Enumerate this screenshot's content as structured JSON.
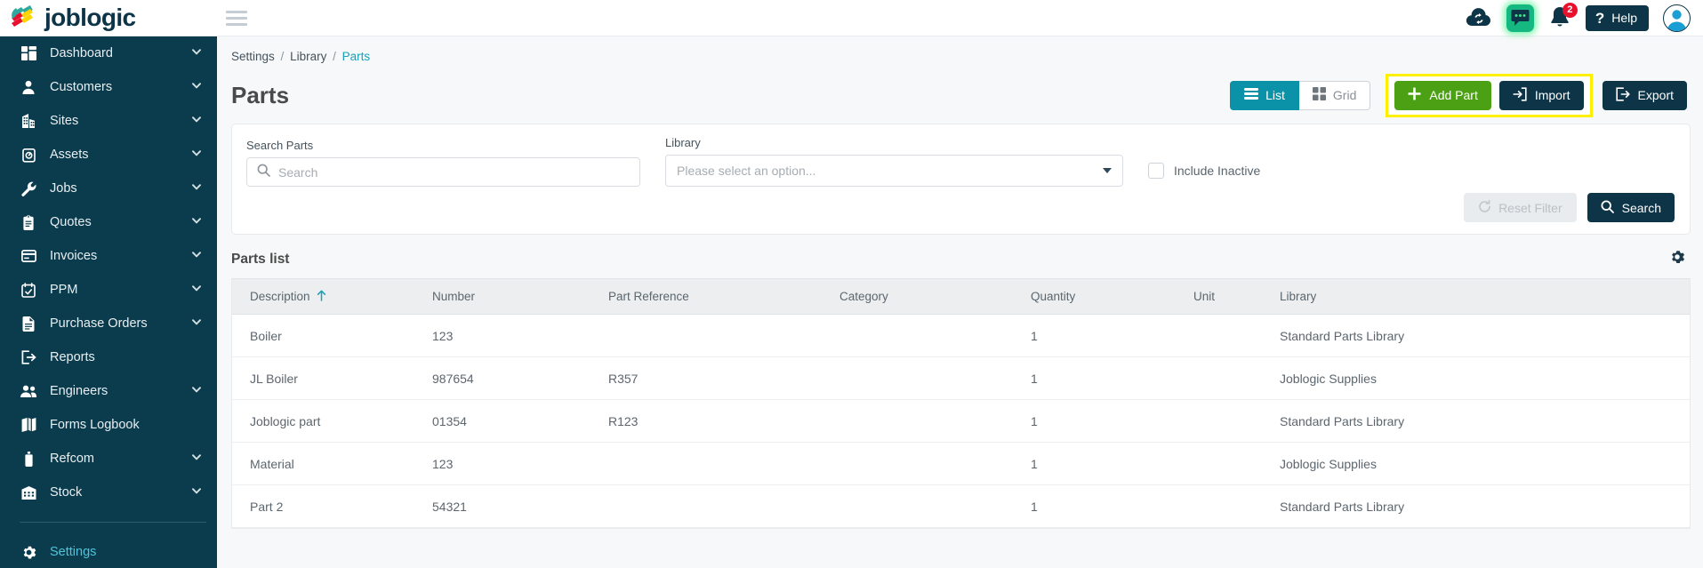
{
  "brand": {
    "name": "joblogic",
    "logo_colors": [
      "#2fa8a0",
      "#e8112d",
      "#ffd400",
      "#0d3547"
    ]
  },
  "topbar": {
    "hamburger_icon": "hamburger-menu-icon",
    "icons": [
      {
        "name": "cloud-sync-icon",
        "label": "Cloud Sync"
      },
      {
        "name": "chat-bubble-icon",
        "label": "Chat"
      },
      {
        "name": "bell-notification-icon",
        "label": "Notifications",
        "badge": "2"
      }
    ],
    "help_label": "Help",
    "help_icon": "question-mark-icon",
    "avatar_icon": "user-avatar-icon"
  },
  "sidebar": {
    "items": [
      {
        "label": "Dashboard",
        "icon": "dashboard-grid-icon",
        "expandable": true
      },
      {
        "label": "Customers",
        "icon": "person-icon",
        "expandable": true
      },
      {
        "label": "Sites",
        "icon": "building-icon",
        "expandable": true
      },
      {
        "label": "Assets",
        "icon": "asset-tag-icon",
        "expandable": true
      },
      {
        "label": "Jobs",
        "icon": "wrench-icon",
        "expandable": true
      },
      {
        "label": "Quotes",
        "icon": "clipboard-icon",
        "expandable": true
      },
      {
        "label": "Invoices",
        "icon": "invoice-card-icon",
        "expandable": true
      },
      {
        "label": "PPM",
        "icon": "calendar-check-icon",
        "expandable": true
      },
      {
        "label": "Purchase Orders",
        "icon": "document-lines-icon",
        "expandable": true
      },
      {
        "label": "Reports",
        "icon": "report-export-icon",
        "expandable": false
      },
      {
        "label": "Engineers",
        "icon": "people-group-icon",
        "expandable": true
      },
      {
        "label": "Forms Logbook",
        "icon": "open-book-icon",
        "expandable": false
      },
      {
        "label": "Refcom",
        "icon": "gas-cylinder-icon",
        "expandable": true
      },
      {
        "label": "Stock",
        "icon": "warehouse-icon",
        "expandable": true
      }
    ],
    "bottom_item": {
      "label": "Settings",
      "icon": "gear-icon",
      "active": true
    }
  },
  "breadcrumb": {
    "items": [
      "Settings",
      "Library",
      "Parts"
    ],
    "separator": "/",
    "active_index": 2
  },
  "header": {
    "title": "Parts",
    "view_toggle": [
      {
        "label": "List",
        "icon": "list-view-icon",
        "selected": true
      },
      {
        "label": "Grid",
        "icon": "grid-view-icon",
        "selected": false
      }
    ],
    "buttons": [
      {
        "label": "Add Part",
        "icon": "plus-icon",
        "style": "green",
        "highlighted": true
      },
      {
        "label": "Import",
        "icon": "import-arrow-icon",
        "style": "dark",
        "highlighted": true
      },
      {
        "label": "Export",
        "icon": "export-arrow-icon",
        "style": "dark",
        "highlighted": false
      }
    ],
    "highlight_color": "#fff000"
  },
  "filters": {
    "search_label": "Search Parts",
    "search_placeholder": "Search",
    "search_value": "",
    "search_icon": "search-icon",
    "library_label": "Library",
    "library_placeholder": "Please select an option...",
    "library_value": "",
    "include_inactive_label": "Include Inactive",
    "include_inactive_checked": false,
    "reset_label": "Reset Filter",
    "reset_icon": "refresh-icon",
    "reset_disabled": true,
    "search_button_label": "Search",
    "search_button_icon": "search-icon"
  },
  "list": {
    "title": "Parts list",
    "settings_icon": "gear-icon",
    "sort_column": "Description",
    "sort_direction": "asc",
    "sort_icon": "arrow-up-icon",
    "columns": [
      "Description",
      "Number",
      "Part Reference",
      "Category",
      "Quantity",
      "Unit",
      "Library"
    ],
    "rows": [
      {
        "description": "Boiler",
        "number": "123",
        "part_reference": "",
        "category": "",
        "quantity": "1",
        "unit": "",
        "library": "Standard Parts Library"
      },
      {
        "description": "JL Boiler",
        "number": "987654",
        "part_reference": "R357",
        "category": "",
        "quantity": "1",
        "unit": "",
        "library": "Joblogic Supplies"
      },
      {
        "description": "Joblogic part",
        "number": "01354",
        "part_reference": "R123",
        "category": "",
        "quantity": "1",
        "unit": "",
        "library": "Standard Parts Library"
      },
      {
        "description": "Material",
        "number": "123",
        "part_reference": "",
        "category": "",
        "quantity": "1",
        "unit": "",
        "library": "Joblogic Supplies"
      },
      {
        "description": "Part 2",
        "number": "54321",
        "part_reference": "",
        "category": "",
        "quantity": "1",
        "unit": "",
        "library": "Standard Parts Library"
      }
    ]
  },
  "colors": {
    "sidebar_bg": "#0b3c4d",
    "accent_teal": "#17a2b8",
    "brand_dark": "#0d3547",
    "green": "#4ba014",
    "list_toggle": "#0c92a8",
    "link": "#3ba7bd"
  }
}
